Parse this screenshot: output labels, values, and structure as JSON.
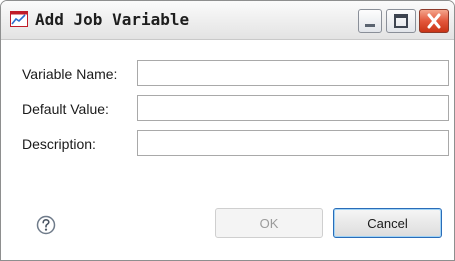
{
  "window": {
    "title": "Add Job Variable",
    "icon": "chart-window-icon",
    "controls": [
      "minimize-icon",
      "maximize-icon",
      "close-icon"
    ]
  },
  "form": {
    "fields": [
      {
        "label": "Variable Name:",
        "value": ""
      },
      {
        "label": "Default Value:",
        "value": ""
      },
      {
        "label": "Description:",
        "value": ""
      }
    ]
  },
  "footer": {
    "help_icon": "question-circle-icon",
    "ok_label": "OK",
    "cancel_label": "Cancel"
  },
  "colors": {
    "close_button": "#d9432a",
    "default_button_border": "#2a6cb8",
    "disabled_text": "#9b9b9b"
  }
}
